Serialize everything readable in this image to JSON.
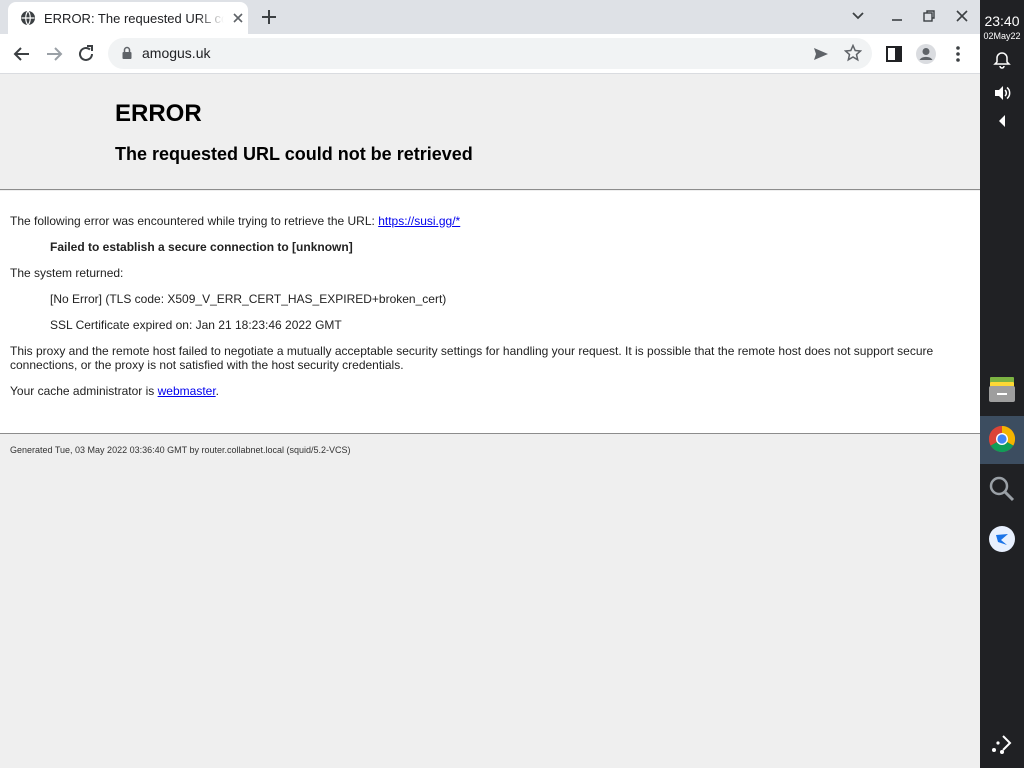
{
  "browser": {
    "tab": {
      "title": "ERROR: The requested URL could not be retrieved"
    },
    "toolbar": {
      "url": "amogus.uk"
    }
  },
  "page": {
    "heading": "ERROR",
    "subheading": "The requested URL could not be retrieved",
    "para1_prefix": "The following error was encountered while trying to retrieve the URL: ",
    "para1_link": "https://susi.gg/*",
    "error_detail": "Failed to establish a secure connection to [unknown]",
    "system_returned_label": "The system returned:",
    "tls_error": "[No Error] (TLS code: X509_V_ERR_CERT_HAS_EXPIRED+broken_cert)",
    "ssl_expired": "SSL Certificate expired on: Jan 21 18:23:46 2022 GMT",
    "explanation": "This proxy and the remote host failed to negotiate a mutually acceptable security settings for handling your request. It is possible that the remote host does not support secure connections, or the proxy is not satisfied with the host security credentials.",
    "admin_prefix": "Your cache administrator is ",
    "admin_link": "webmaster",
    "admin_suffix": ".",
    "footer": "Generated Tue, 03 May 2022 03:36:40 GMT by router.collabnet.local (squid/5.2-VCS)"
  },
  "shelf": {
    "time": "23:40",
    "date": "02May22"
  },
  "colors": {
    "link": "#0000ee",
    "shelf_bg": "#202124",
    "tabstrip_bg": "#dee1e6"
  }
}
